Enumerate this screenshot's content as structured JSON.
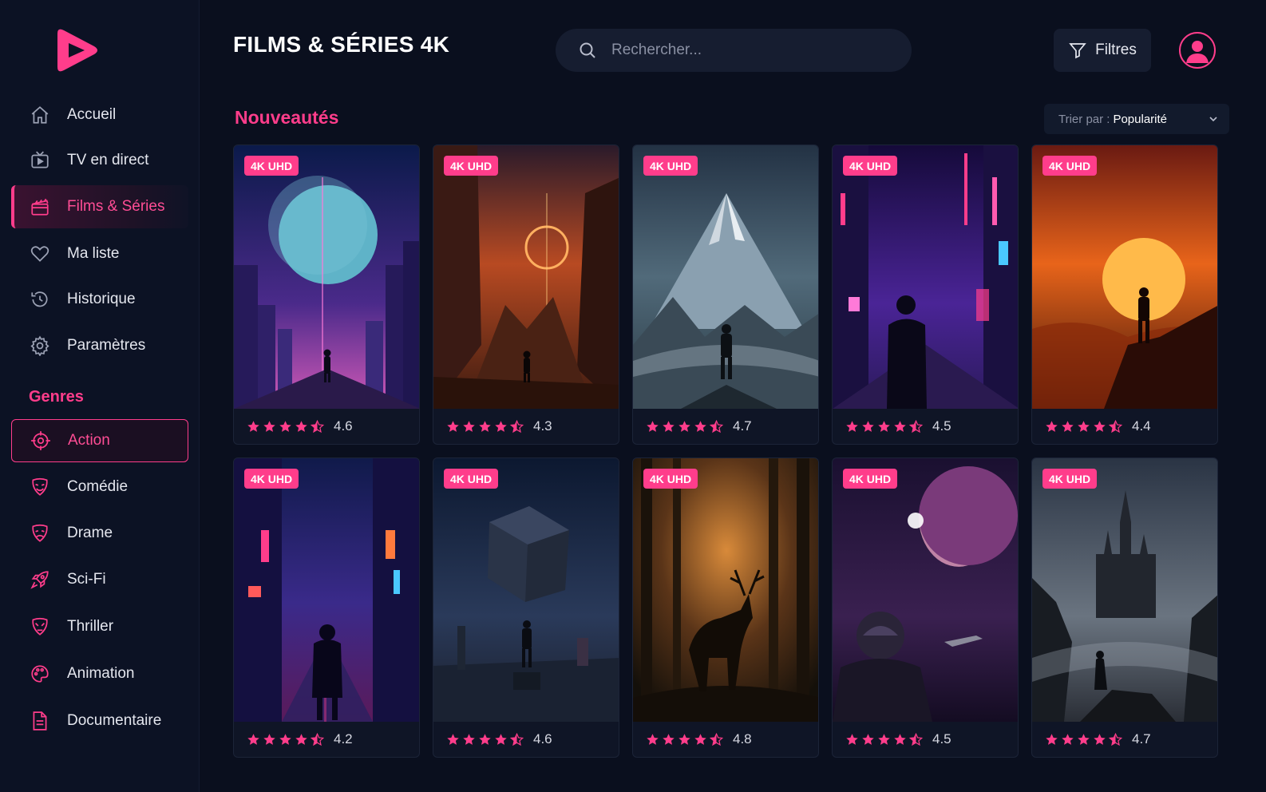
{
  "app": {
    "title": "FILMS & SÉRIES 4K"
  },
  "sidebar": {
    "nav": [
      {
        "label": "Accueil",
        "icon": "home-icon"
      },
      {
        "label": "TV en direct",
        "icon": "tv-icon"
      },
      {
        "label": "Films & Séries",
        "icon": "clapperboard-icon",
        "active": true
      },
      {
        "label": "Ma liste",
        "icon": "heart-icon"
      },
      {
        "label": "Historique",
        "icon": "history-icon"
      },
      {
        "label": "Paramètres",
        "icon": "gear-icon"
      }
    ],
    "genres_title": "Genres",
    "genres": [
      {
        "label": "Action",
        "icon": "crosshair-icon",
        "selected": true
      },
      {
        "label": "Comédie",
        "icon": "comedy-mask-icon"
      },
      {
        "label": "Drame",
        "icon": "drama-mask-icon"
      },
      {
        "label": "Sci-Fi",
        "icon": "rocket-icon"
      },
      {
        "label": "Thriller",
        "icon": "thriller-mask-icon"
      },
      {
        "label": "Animation",
        "icon": "palette-icon"
      },
      {
        "label": "Documentaire",
        "icon": "document-icon"
      }
    ]
  },
  "header": {
    "search_placeholder": "Rechercher...",
    "filter_label": "Filtres"
  },
  "section": {
    "title": "Nouveautés",
    "sort_prefix": "Trier par :",
    "sort_value": "Popularité"
  },
  "colors": {
    "accent": "#ff3d8b",
    "background": "#0a0f1e",
    "sidebar": "#0c1224"
  },
  "cards": [
    {
      "badge": "4K UHD",
      "rating": "4.6",
      "stars": 4.5,
      "scene": "neon-city-moon"
    },
    {
      "badge": "4K UHD",
      "rating": "4.3",
      "stars": 4.5,
      "scene": "orange-canyon-ring"
    },
    {
      "badge": "4K UHD",
      "rating": "4.7",
      "stars": 4.5,
      "scene": "snowy-mountain"
    },
    {
      "badge": "4K UHD",
      "rating": "4.5",
      "stars": 4.5,
      "scene": "cyberpunk-street"
    },
    {
      "badge": "4K UHD",
      "rating": "4.4",
      "stars": 4.5,
      "scene": "sunset-cliff"
    },
    {
      "badge": "4K UHD",
      "rating": "4.2",
      "stars": 4.5,
      "scene": "rainy-neon-street"
    },
    {
      "badge": "4K UHD",
      "rating": "4.6",
      "stars": 4.5,
      "scene": "floating-cube"
    },
    {
      "badge": "4K UHD",
      "rating": "4.8",
      "stars": 4.5,
      "scene": "forest-stag"
    },
    {
      "badge": "4K UHD",
      "rating": "4.5",
      "stars": 4.5,
      "scene": "astronaut-planet"
    },
    {
      "badge": "4K UHD",
      "rating": "4.7",
      "stars": 4.5,
      "scene": "gothic-castle"
    }
  ]
}
